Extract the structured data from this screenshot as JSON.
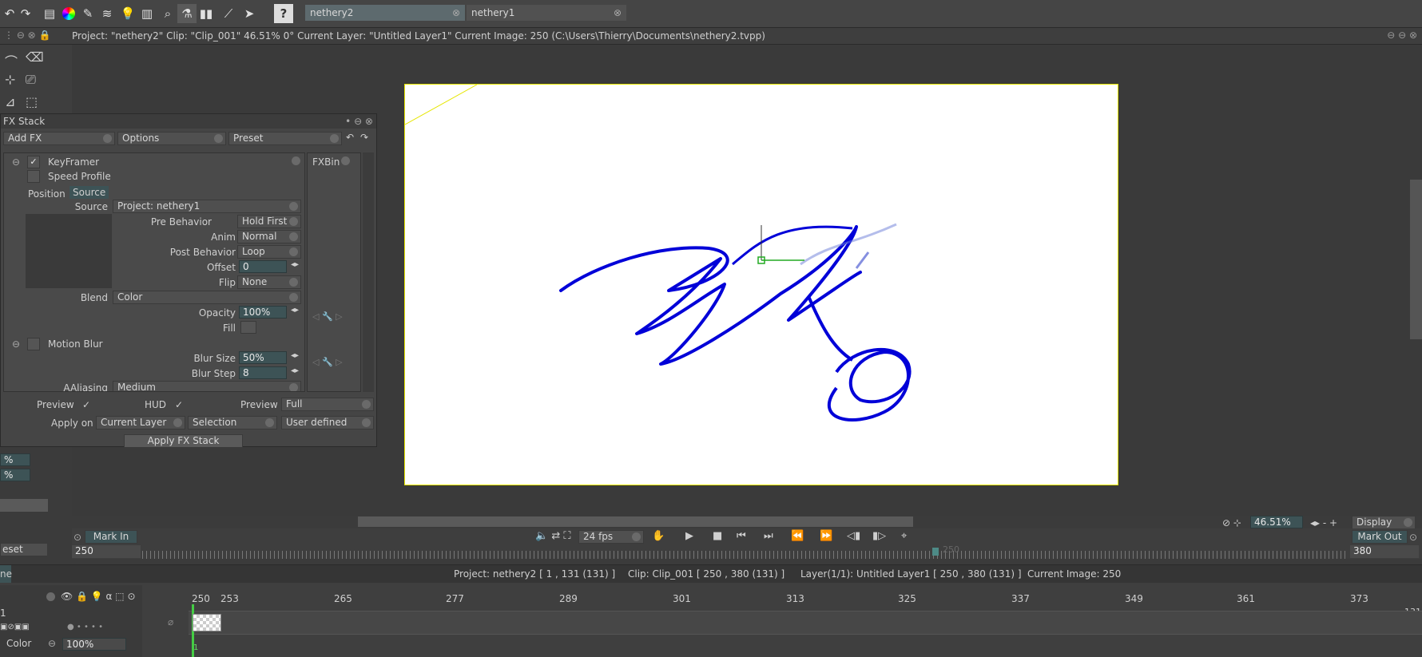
{
  "toolbar": {
    "tabs": [
      {
        "label": "nethery2",
        "active": true
      },
      {
        "label": "nethery1",
        "active": false
      }
    ],
    "icons": [
      "redo-arrow-icon",
      "toolbox-icon",
      "color-wheel-icon",
      "brush-tools-icon",
      "layers-icon",
      "light-icon",
      "pen-tablet-icon",
      "search-icon",
      "fx-stack-icon",
      "library-icon",
      "graph-icon",
      "send-icon",
      "help-icon"
    ]
  },
  "info": {
    "text": "Project:  \"nethery2\"  Clip: \"Clip_001\"  46.51%  0°  Current Layer: \"Untitled Layer1\"  Current Image: 250 (C:\\Users\\Thierry\\Documents\\nethery2.tvpp)"
  },
  "fx": {
    "title": "FX Stack",
    "add_fx": "Add FX",
    "options": "Options",
    "preset": "Preset",
    "keyframer": "KeyFramer",
    "speed_profile": "Speed Profile",
    "tab_position": "Position",
    "tab_source": "Source",
    "fxbin": "FXBin",
    "rows": {
      "source_label": "Source",
      "source_value": "Project: nethery1",
      "pre_label": "Pre Behavior",
      "pre_value": "Hold First",
      "anim_label": "Anim",
      "anim_value": "Normal",
      "post_label": "Post Behavior",
      "post_value": "Loop",
      "offset_label": "Offset",
      "offset_value": "0",
      "flip_label": "Flip",
      "flip_value": "None",
      "blend_label": "Blend",
      "blend_value": "Color",
      "opacity_label": "Opacity",
      "opacity_value": "100%",
      "fill_label": "Fill"
    },
    "motion_blur": "Motion Blur",
    "blur_size_label": "Blur Size",
    "blur_size_value": "50%",
    "blur_step_label": "Blur Step",
    "blur_step_value": "8",
    "aliasing_label": "AAliasing",
    "aliasing_value": "Medium",
    "preview_label": "Preview",
    "hud_label": "HUD",
    "preview2_label": "Preview",
    "preview2_value": "Full",
    "apply_on_label": "Apply on",
    "apply_on_value": "Current Layer",
    "selection_value": "Selection",
    "user_defined_value": "User defined",
    "apply_button": "Apply FX Stack"
  },
  "left_values": {
    "v1": "%",
    "v2": "%",
    "reset": "eset"
  },
  "transport": {
    "mark_in": "Mark In",
    "mark_in_value": "250",
    "fps": "24 fps",
    "mark_out": "Mark Out",
    "mark_out_value": "380",
    "zoom": "46.51%",
    "display": "Display",
    "marker_value": "250"
  },
  "status": {
    "project": "Project: nethery2 [ 1 , 131  (131) ]",
    "clip": "Clip: Clip_001 [ 250 , 380  (131) ]",
    "layer": "Layer(1/1): Untitled Layer1 [ 250 , 380  (131) ]",
    "image": "Current Image: 250",
    "left_tab": "ne"
  },
  "timeline": {
    "numbers": [
      "250",
      "253",
      "265",
      "277",
      "289",
      "301",
      "313",
      "325",
      "337",
      "349",
      "361",
      "373"
    ],
    "end_num": "131",
    "layer_num": "1",
    "color_label": "Color",
    "opacity": "100%",
    "frame_num": "1"
  }
}
